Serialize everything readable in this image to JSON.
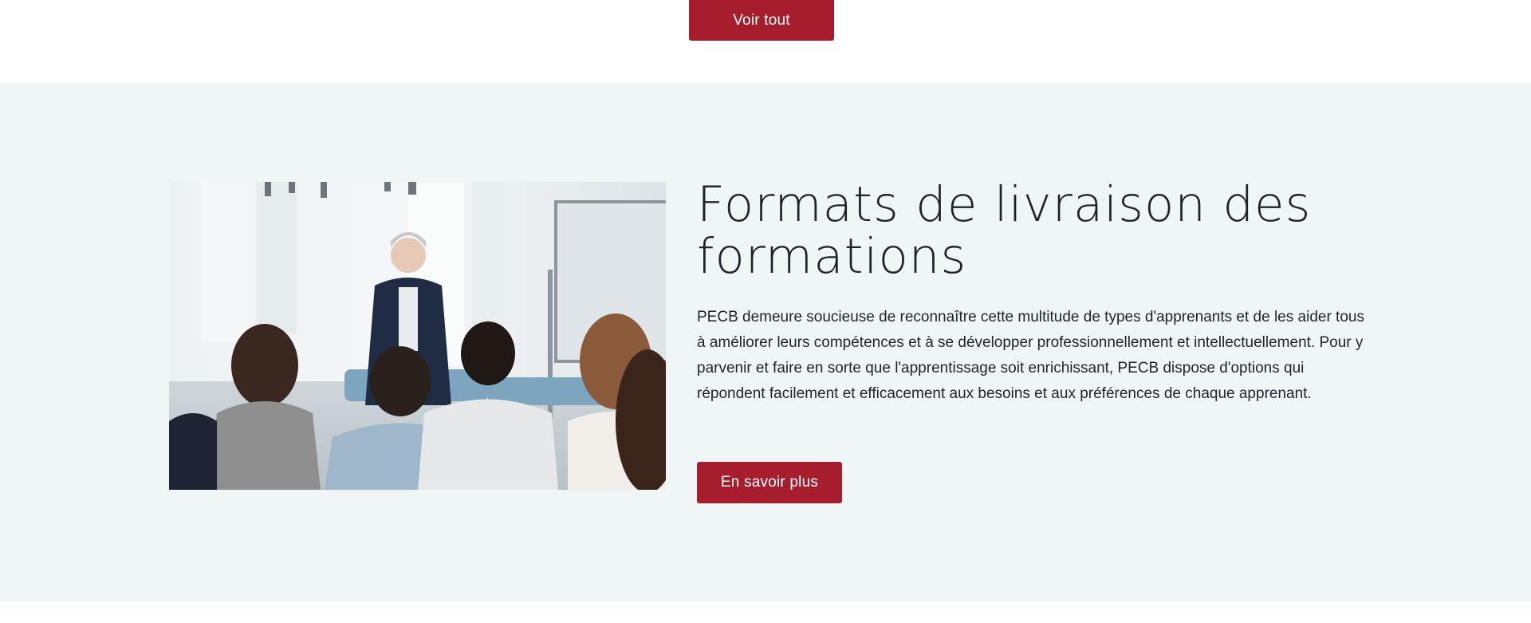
{
  "top": {
    "voir_tout_label": "Voir tout"
  },
  "formats": {
    "title": "Formats de livraison des formations",
    "description": "PECB demeure soucieuse de reconnaître cette multitude de types d'apprenants et de les aider tous à améliorer leurs compétences et à se développer professionnellement et intellectuellement. Pour y parvenir et faire en sorte que l'apprentissage soit enrichissant, PECB dispose d'options qui répondent facilement et efficacement aux besoins et aux préférences de chaque apprenant.",
    "cta_label": "En savoir plus",
    "image_subject": "training-classroom-photo"
  },
  "colors": {
    "accent": "#a61e2e",
    "section_bg": "#f0f6f6",
    "text": "#1d2329"
  }
}
